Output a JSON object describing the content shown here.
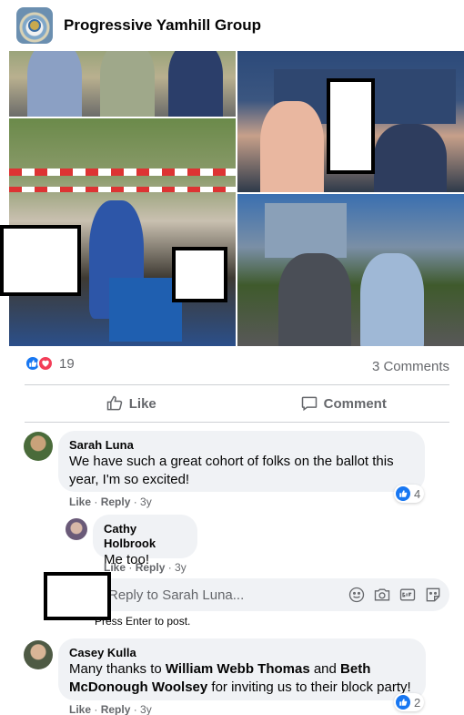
{
  "header": {
    "group_name": "Progressive Yamhill Group"
  },
  "post": {
    "reaction_count": "19",
    "comment_count": "3 Comments",
    "like_label": "Like",
    "comment_label": "Comment"
  },
  "comments": [
    {
      "author": "Sarah Luna",
      "text": "We have such a great cohort of folks on the ballot this year, I'm so excited!",
      "like": "Like",
      "reply": "Reply",
      "age": "3y",
      "reactions": "4"
    },
    {
      "author": "Cathy Holbrook",
      "text": "Me too!",
      "like": "Like",
      "reply": "Reply",
      "age": "3y"
    },
    {
      "author": "Casey Kulla",
      "text_part1": "Many thanks to ",
      "mention1": "William Webb Thomas",
      "text_part2": " and ",
      "mention2": "Beth McDonough Woolsey",
      "text_part3": " for inviting us to their block party!",
      "like": "Like",
      "reply": "Reply",
      "age": "3y",
      "reactions": "2"
    }
  ],
  "reply_box": {
    "placeholder": "Reply to Sarah Luna...",
    "hint": "Press Enter to post."
  },
  "colors": {
    "like_blue": "#1877f2",
    "love_red": "#f33e58",
    "bubble_gray": "#f0f2f5",
    "meta_gray": "#65676b"
  },
  "icons": [
    "group-avatar",
    "like-reaction-icon",
    "love-reaction-icon",
    "thumbs-up-icon",
    "comment-icon",
    "emoji-icon",
    "camera-icon",
    "gif-icon",
    "sticker-icon"
  ]
}
